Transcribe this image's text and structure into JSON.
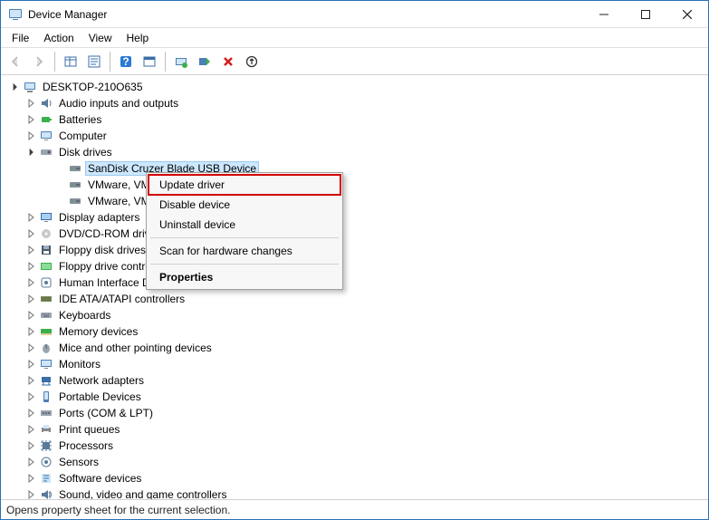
{
  "title": "Device Manager",
  "window_controls": {
    "minimize": "—",
    "maximize": "☐",
    "close": "✕"
  },
  "menubar": [
    "File",
    "Action",
    "View",
    "Help"
  ],
  "toolbar": [
    {
      "id": "back",
      "enabled": false
    },
    {
      "id": "forward",
      "enabled": false
    },
    {
      "id": "sep"
    },
    {
      "id": "show-hidden"
    },
    {
      "id": "properties"
    },
    {
      "id": "sep"
    },
    {
      "id": "help"
    },
    {
      "id": "view-prop"
    },
    {
      "id": "sep"
    },
    {
      "id": "update-driver"
    },
    {
      "id": "uninstall"
    },
    {
      "id": "disable"
    },
    {
      "id": "scan"
    }
  ],
  "root": {
    "label": "DESKTOP-210O635",
    "expanded": true
  },
  "devices": [
    {
      "icon": "audio",
      "label": "Audio inputs and outputs",
      "expanded": false
    },
    {
      "icon": "battery",
      "label": "Batteries",
      "expanded": false
    },
    {
      "icon": "computer",
      "label": "Computer",
      "expanded": false
    },
    {
      "icon": "disk",
      "label": "Disk drives",
      "expanded": true,
      "children": [
        {
          "icon": "drive",
          "label": "SanDisk Cruzer Blade USB Device",
          "selected": true
        },
        {
          "icon": "drive",
          "label": "VMware, VMware Virtual S SCSI Disk Device"
        },
        {
          "icon": "drive",
          "label": "VMware, VMware Virtual S SCSI Disk Device"
        }
      ]
    },
    {
      "icon": "display",
      "label": "Display adapters",
      "expanded": false
    },
    {
      "icon": "dvd",
      "label": "DVD/CD-ROM drives",
      "expanded": false
    },
    {
      "icon": "floppyd",
      "label": "Floppy disk drives",
      "expanded": false
    },
    {
      "icon": "floppyc",
      "label": "Floppy drive controllers",
      "expanded": false
    },
    {
      "icon": "hid",
      "label": "Human Interface Devices",
      "expanded": false
    },
    {
      "icon": "ide",
      "label": "IDE ATA/ATAPI controllers",
      "expanded": false
    },
    {
      "icon": "keyboard",
      "label": "Keyboards",
      "expanded": false
    },
    {
      "icon": "memory",
      "label": "Memory devices",
      "expanded": false
    },
    {
      "icon": "mouse",
      "label": "Mice and other pointing devices",
      "expanded": false
    },
    {
      "icon": "monitor",
      "label": "Monitors",
      "expanded": false
    },
    {
      "icon": "network",
      "label": "Network adapters",
      "expanded": false
    },
    {
      "icon": "portable",
      "label": "Portable Devices",
      "expanded": false
    },
    {
      "icon": "ports",
      "label": "Ports (COM & LPT)",
      "expanded": false
    },
    {
      "icon": "print",
      "label": "Print queues",
      "expanded": false
    },
    {
      "icon": "cpu",
      "label": "Processors",
      "expanded": false
    },
    {
      "icon": "sensor",
      "label": "Sensors",
      "expanded": false
    },
    {
      "icon": "software",
      "label": "Software devices",
      "expanded": false
    },
    {
      "icon": "sound",
      "label": "Sound, video and game controllers",
      "expanded": false
    }
  ],
  "context_menu": [
    {
      "label": "Update driver",
      "highlight": true
    },
    {
      "label": "Disable device"
    },
    {
      "label": "Uninstall device"
    },
    {
      "sep": true
    },
    {
      "label": "Scan for hardware changes"
    },
    {
      "sep": true
    },
    {
      "label": "Properties",
      "bold": true
    }
  ],
  "statusbar": "Opens property sheet for the current selection."
}
